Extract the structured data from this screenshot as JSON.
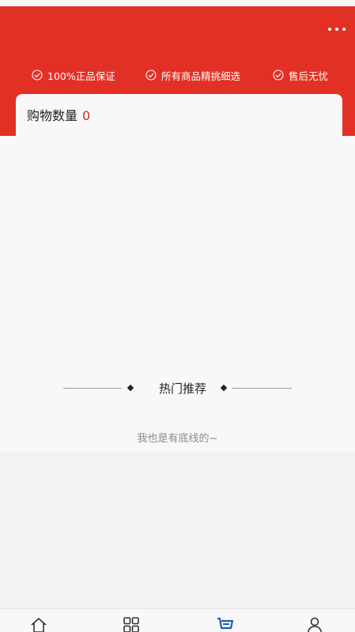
{
  "header": {
    "accent_color": "#e33025",
    "more_icon": "more-dots-icon",
    "guarantees": [
      {
        "icon": "check-circle-icon",
        "label": "100%正品保证"
      },
      {
        "icon": "check-circle-icon",
        "label": "所有商品精挑细选"
      },
      {
        "icon": "check-circle-icon",
        "label": "售后无忧"
      }
    ]
  },
  "cart": {
    "count_label": "购物数量",
    "count_value": "0",
    "count_color": "#c4302a"
  },
  "recommend": {
    "title": "热门推荐"
  },
  "footer_note": "我也是有底线的~",
  "tabbar": {
    "active_color": "#1a5fb4",
    "items": [
      {
        "icon": "home-icon",
        "active": false
      },
      {
        "icon": "category-grid-icon",
        "active": false
      },
      {
        "icon": "cart-icon",
        "active": true
      },
      {
        "icon": "user-icon",
        "active": false
      }
    ]
  }
}
